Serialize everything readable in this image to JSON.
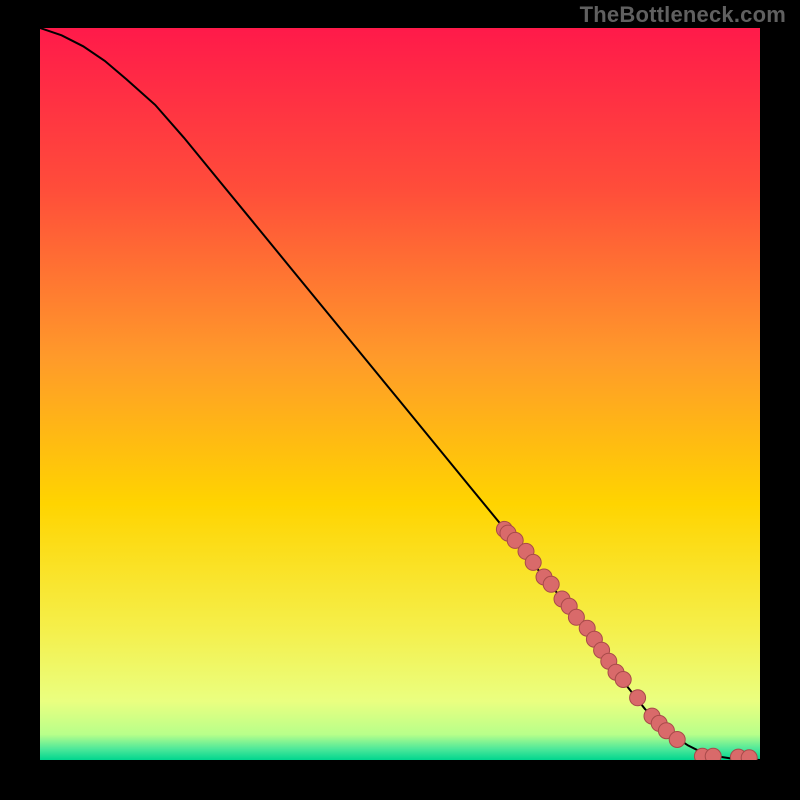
{
  "watermark": "TheBottleneck.com",
  "colors": {
    "gradient_top": "#ff1a4a",
    "gradient_mid": "#ffd400",
    "gradient_low": "#f7ff70",
    "gradient_green": "#00e676",
    "curve": "#000000",
    "marker_fill": "#d96a6a",
    "marker_stroke": "#a84a4a",
    "frame": "#000000"
  },
  "chart_data": {
    "type": "line",
    "title": "",
    "xlabel": "",
    "ylabel": "",
    "xlim": [
      0,
      100
    ],
    "ylim": [
      0,
      100
    ],
    "series": [
      {
        "name": "bottleneck-curve",
        "x": [
          0,
          3,
          6,
          9,
          12,
          16,
          20,
          25,
          30,
          35,
          40,
          45,
          50,
          55,
          60,
          65,
          70,
          75,
          78,
          80,
          82,
          84,
          86,
          88,
          90,
          92,
          94,
          96,
          98,
          100
        ],
        "values": [
          100,
          99,
          97.5,
          95.5,
          93,
          89.5,
          85,
          79,
          73,
          67,
          61,
          55,
          49,
          43,
          37,
          31,
          25,
          19,
          15,
          12,
          9.5,
          7,
          5,
          3.3,
          2,
          1,
          0.5,
          0.2,
          0.1,
          0
        ]
      }
    ],
    "scatter_points": {
      "name": "data-points",
      "x": [
        64.5,
        65,
        66,
        67.5,
        68.5,
        70,
        71,
        72.5,
        73.5,
        74.5,
        76,
        77,
        78,
        79,
        80,
        81,
        83,
        85,
        86,
        87,
        88.5,
        92,
        93.5,
        97,
        98.5
      ],
      "values": [
        31.5,
        31,
        30,
        28.5,
        27,
        25,
        24,
        22,
        21,
        19.5,
        18,
        16.5,
        15,
        13.5,
        12,
        11,
        8.5,
        6,
        5,
        4,
        2.8,
        0.5,
        0.5,
        0.4,
        0.3
      ]
    }
  }
}
